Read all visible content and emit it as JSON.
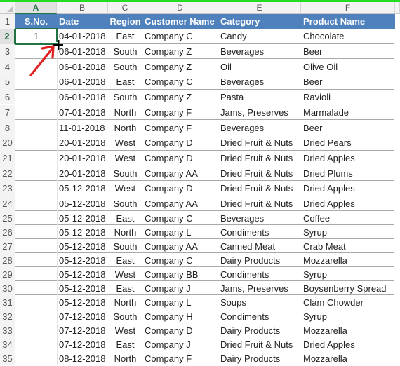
{
  "window": {
    "accent_color": "#22dd22",
    "selection_color": "#217346",
    "header_fill_color": "#4f81bd"
  },
  "columns": [
    "A",
    "B",
    "C",
    "D",
    "E",
    "F"
  ],
  "selected_column": "A",
  "selected_cell": "A2",
  "header_row": {
    "row_number": "1",
    "cells": [
      "S.No.",
      "Date",
      "Region",
      "Customer Name",
      "Category",
      "Product Name"
    ]
  },
  "rows": [
    {
      "row_number": "2",
      "sno": "1",
      "date": "04-01-2018",
      "region": "East",
      "customer": "Company C",
      "category": "Candy",
      "product": "Chocolate"
    },
    {
      "row_number": "3",
      "sno": "",
      "date": "06-01-2018",
      "region": "South",
      "customer": "Company Z",
      "category": "Beverages",
      "product": "Beer"
    },
    {
      "row_number": "4",
      "sno": "",
      "date": "06-01-2018",
      "region": "South",
      "customer": "Company Z",
      "category": "Oil",
      "product": "Olive Oil"
    },
    {
      "row_number": "5",
      "sno": "",
      "date": "06-01-2018",
      "region": "East",
      "customer": "Company C",
      "category": "Beverages",
      "product": "Beer"
    },
    {
      "row_number": "6",
      "sno": "",
      "date": "06-01-2018",
      "region": "South",
      "customer": "Company Z",
      "category": "Pasta",
      "product": "Ravioli"
    },
    {
      "row_number": "7",
      "sno": "",
      "date": "07-01-2018",
      "region": "North",
      "customer": "Company F",
      "category": "Jams, Preserves",
      "product": "Marmalade"
    },
    {
      "row_number": "8",
      "sno": "",
      "date": "11-01-2018",
      "region": "North",
      "customer": "Company F",
      "category": "Beverages",
      "product": "Beer"
    },
    {
      "row_number": "20",
      "sno": "",
      "date": "20-01-2018",
      "region": "West",
      "customer": "Company D",
      "category": "Dried Fruit & Nuts",
      "product": "Dried Pears"
    },
    {
      "row_number": "21",
      "sno": "",
      "date": "20-01-2018",
      "region": "West",
      "customer": "Company D",
      "category": "Dried Fruit & Nuts",
      "product": "Dried Apples"
    },
    {
      "row_number": "22",
      "sno": "",
      "date": "20-01-2018",
      "region": "South",
      "customer": "Company AA",
      "category": "Dried Fruit & Nuts",
      "product": "Dried Plums"
    },
    {
      "row_number": "23",
      "sno": "",
      "date": "05-12-2018",
      "region": "West",
      "customer": "Company D",
      "category": "Dried Fruit & Nuts",
      "product": "Dried Apples"
    },
    {
      "row_number": "24",
      "sno": "",
      "date": "05-12-2018",
      "region": "South",
      "customer": "Company AA",
      "category": "Dried Fruit & Nuts",
      "product": "Dried Apples"
    },
    {
      "row_number": "25",
      "sno": "",
      "date": "05-12-2018",
      "region": "East",
      "customer": "Company C",
      "category": "Beverages",
      "product": "Coffee"
    },
    {
      "row_number": "26",
      "sno": "",
      "date": "05-12-2018",
      "region": "North",
      "customer": "Company L",
      "category": "Condiments",
      "product": "Syrup"
    },
    {
      "row_number": "27",
      "sno": "",
      "date": "05-12-2018",
      "region": "South",
      "customer": "Company AA",
      "category": "Canned Meat",
      "product": "Crab Meat"
    },
    {
      "row_number": "28",
      "sno": "",
      "date": "05-12-2018",
      "region": "East",
      "customer": "Company C",
      "category": "Dairy Products",
      "product": "Mozzarella"
    },
    {
      "row_number": "29",
      "sno": "",
      "date": "05-12-2018",
      "region": "West",
      "customer": "Company BB",
      "category": "Condiments",
      "product": "Syrup"
    },
    {
      "row_number": "30",
      "sno": "",
      "date": "05-12-2018",
      "region": "East",
      "customer": "Company J",
      "category": "Jams, Preserves",
      "product": "Boysenberry Spread"
    },
    {
      "row_number": "31",
      "sno": "",
      "date": "05-12-2018",
      "region": "North",
      "customer": "Company L",
      "category": "Soups",
      "product": "Clam Chowder"
    },
    {
      "row_number": "32",
      "sno": "",
      "date": "07-12-2018",
      "region": "South",
      "customer": "Company H",
      "category": "Condiments",
      "product": "Syrup"
    },
    {
      "row_number": "33",
      "sno": "",
      "date": "07-12-2018",
      "region": "West",
      "customer": "Company D",
      "category": "Dairy Products",
      "product": "Mozzarella"
    },
    {
      "row_number": "34",
      "sno": "",
      "date": "07-12-2018",
      "region": "East",
      "customer": "Company J",
      "category": "Dried Fruit & Nuts",
      "product": "Dried Apples"
    },
    {
      "row_number": "35",
      "sno": "",
      "date": "08-12-2018",
      "region": "North",
      "customer": "Company F",
      "category": "Dairy Products",
      "product": "Mozzarella"
    }
  ],
  "annotations": {
    "cursor": "crosshair-fill-handle-icon",
    "arrow": "red-arrow-icon",
    "arrow_color": "#e02020"
  }
}
